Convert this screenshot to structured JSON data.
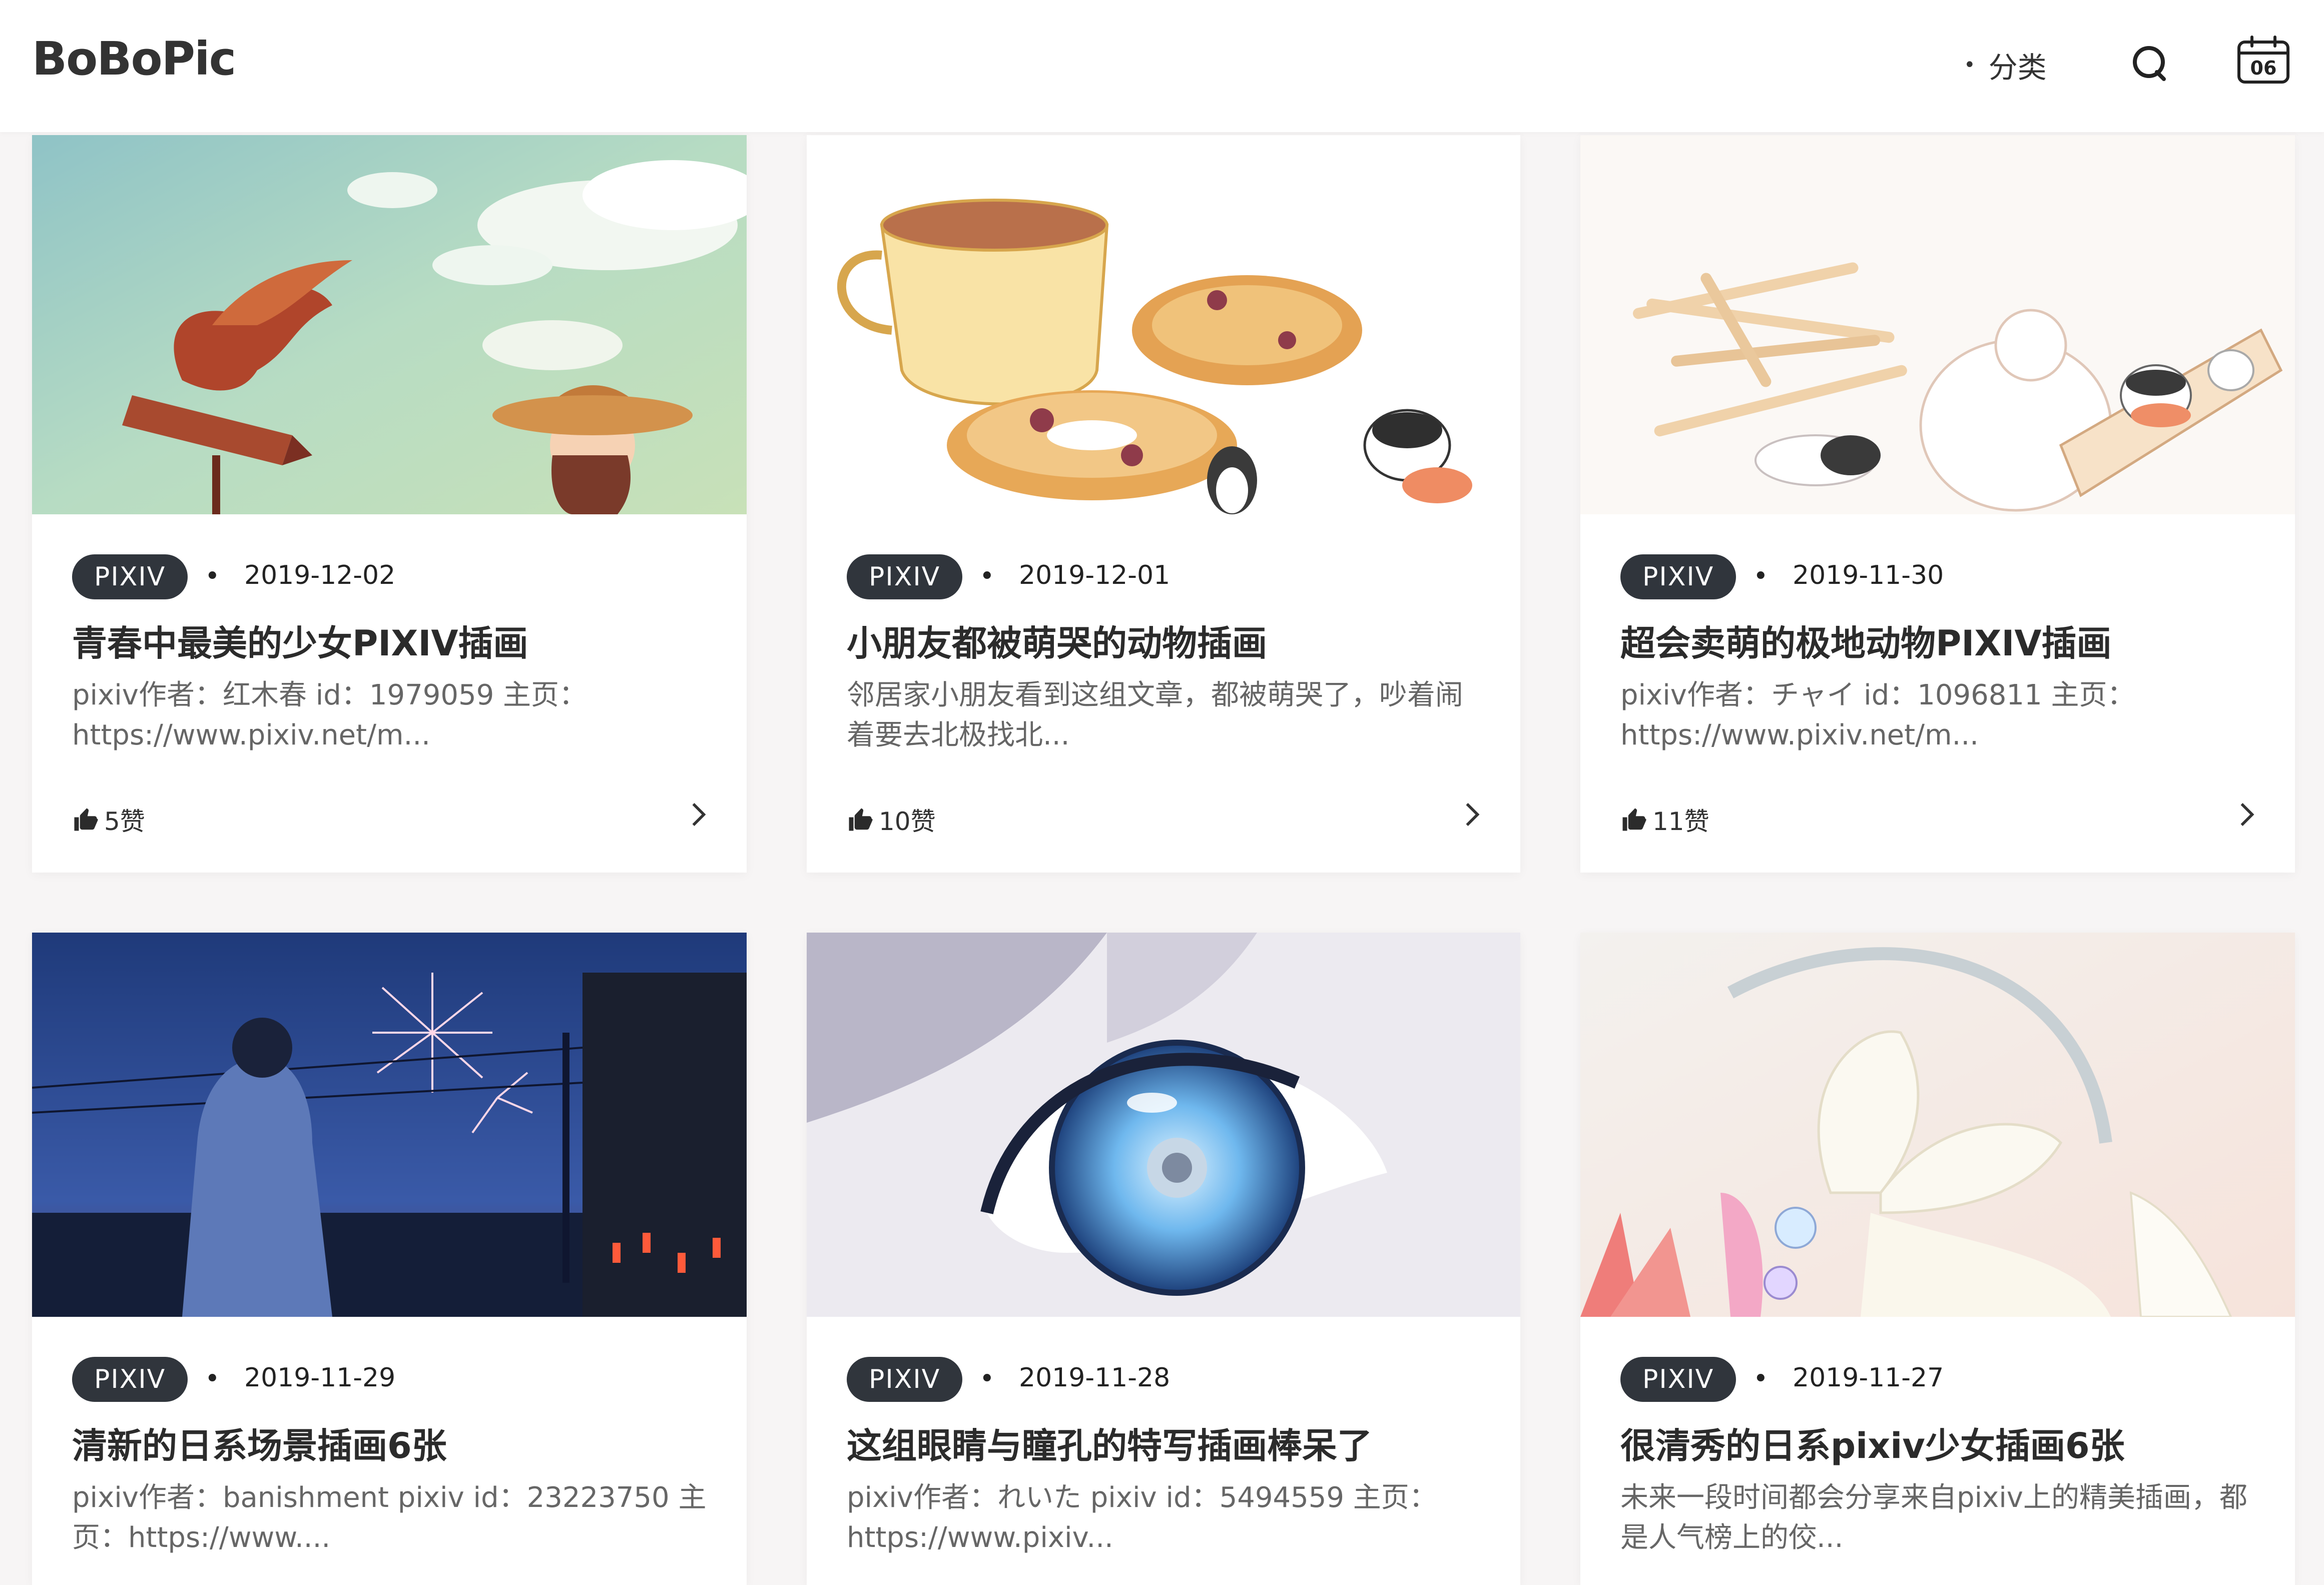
{
  "header": {
    "logo": "BoBoPic",
    "nav_category": "分类",
    "calendar_day": "06"
  },
  "posts": [
    {
      "tag": "PIXIV",
      "date": "2019-12-02",
      "title": "青春中最美的少女PIXIV插画",
      "excerpt": "pixiv作者：红木春 id：1979059 主页：https://www.pixiv.net/m...",
      "likes": "5赞"
    },
    {
      "tag": "PIXIV",
      "date": "2019-12-01",
      "title": "小朋友都被萌哭的动物插画",
      "excerpt": "邻居家小朋友看到这组文章，都被萌哭了，吵着闹着要去北极找北...",
      "likes": "10赞"
    },
    {
      "tag": "PIXIV",
      "date": "2019-11-30",
      "title": "超会卖萌的极地动物PIXIV插画",
      "excerpt": "pixiv作者：チャイ id：1096811 主页：https://www.pixiv.net/m...",
      "likes": "11赞"
    },
    {
      "tag": "PIXIV",
      "date": "2019-11-29",
      "title": "清新的日系场景插画6张",
      "excerpt": "pixiv作者：banishment pixiv id：23223750 主页：https://www....",
      "likes": ""
    },
    {
      "tag": "PIXIV",
      "date": "2019-11-28",
      "title": "这组眼睛与瞳孔的特写插画棒呆了",
      "excerpt": "pixiv作者：れいた pixiv id：5494559 主页：https://www.pixiv...",
      "likes": ""
    },
    {
      "tag": "PIXIV",
      "date": "2019-11-27",
      "title": "很清秀的日系pixiv少女插画6张",
      "excerpt": "未来一段时间都会分享来自pixiv上的精美插画，都是人气榜上的佼...",
      "likes": ""
    }
  ]
}
